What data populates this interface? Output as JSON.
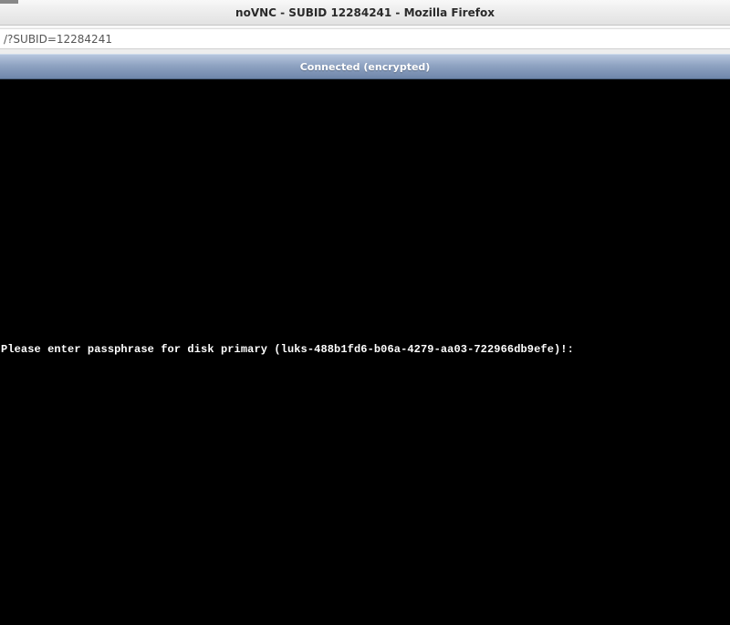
{
  "window": {
    "title": "noVNC - SUBID 12284241 - Mozilla Firefox"
  },
  "urlbar": {
    "value": "/?SUBID=12284241"
  },
  "vnc": {
    "status": "Connected (encrypted)",
    "console_prompt": "Please enter passphrase for disk primary (luks-488b1fd6-b06a-4279-aa03-722966db9efe)!:"
  }
}
